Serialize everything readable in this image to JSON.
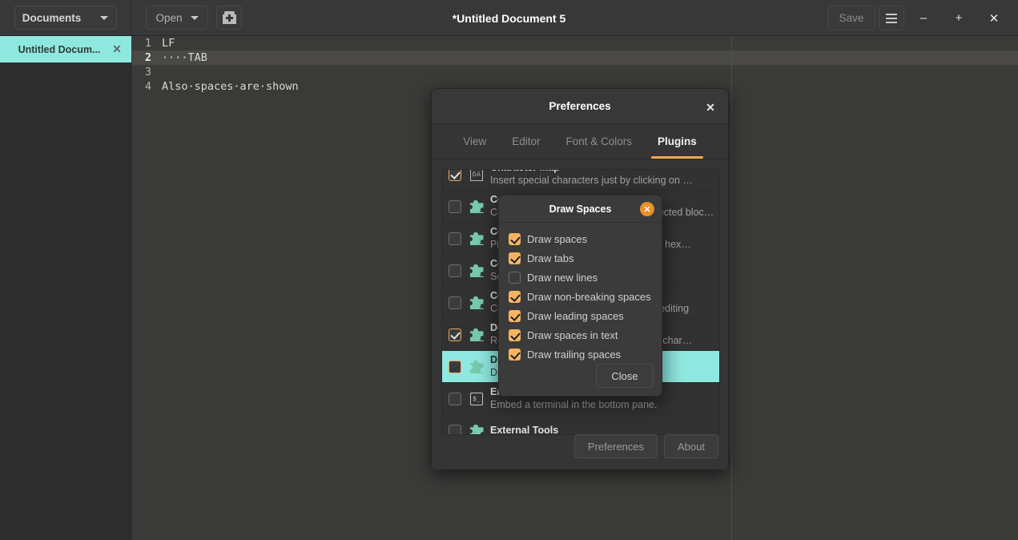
{
  "window": {
    "title": "*Untitled Document 5",
    "documents_label": "Documents",
    "open_label": "Open",
    "save_label": "Save",
    "new_doc_icon": "new-document-icon",
    "menu_icon": "hamburger-menu-icon",
    "minimize_label": "–",
    "maximize_label": "+",
    "close_label": "✕"
  },
  "sidebar": {
    "tabs": [
      {
        "label": "Untitled Docum...",
        "close": "✕",
        "selected": true
      }
    ]
  },
  "editor": {
    "lines": [
      {
        "num": "1",
        "text": "LF",
        "current": false
      },
      {
        "num": "2",
        "text": "····TAB",
        "current": true
      },
      {
        "num": "3",
        "text": "",
        "current": false
      },
      {
        "num": "4",
        "text": "Also·spaces·are·shown",
        "current": false
      }
    ]
  },
  "preferences": {
    "title": "Preferences",
    "close": "✕",
    "tabs": [
      {
        "label": "View",
        "active": false
      },
      {
        "label": "Editor",
        "active": false
      },
      {
        "label": "Font & Colors",
        "active": false
      },
      {
        "label": "Plugins",
        "active": true
      }
    ],
    "accent_color": "#f5a854",
    "plugins": [
      {
        "title": "Character Map",
        "desc": "Insert special characters just by clicking on …",
        "checked": true,
        "icon": "character-map-icon",
        "selected": false
      },
      {
        "title": "Code Comment",
        "desc": "Comment or uncomment blocks of selected bloc…",
        "checked": false,
        "icon": "puzzle-piece-icon",
        "selected": false
      },
      {
        "title": "Color Picker",
        "desc": "Pick a color from a dialog and insert its hex…",
        "checked": false,
        "icon": "puzzle-piece-icon",
        "selected": false
      },
      {
        "title": "Color Scheme Editor",
        "desc": "Source code color schemes editor",
        "checked": false,
        "icon": "puzzle-piece-icon",
        "selected": false
      },
      {
        "title": "Commander",
        "desc": "Command line interface for advanced editing",
        "checked": false,
        "icon": "puzzle-piece-icon",
        "selected": false
      },
      {
        "title": "Document Statistics",
        "desc": "Report the number of words, lines and char…",
        "checked": true,
        "icon": "puzzle-piece-icon",
        "selected": false
      },
      {
        "title": "Draw Spaces",
        "desc": "Draw spaces and tabs",
        "checked": true,
        "icon": "puzzle-piece-icon",
        "selected": true
      },
      {
        "title": "Embedded Terminal",
        "desc": "Embed a terminal in the bottom pane.",
        "checked": false,
        "icon": "terminal-icon",
        "selected": false
      },
      {
        "title": "External Tools",
        "desc": "",
        "checked": false,
        "icon": "puzzle-piece-icon",
        "selected": false
      }
    ],
    "footer": {
      "preferences_label": "Preferences",
      "about_label": "About"
    }
  },
  "draw_spaces": {
    "title": "Draw Spaces",
    "close_icon": "close-circle-icon",
    "options": [
      {
        "label": "Draw spaces",
        "checked": true
      },
      {
        "label": "Draw tabs",
        "checked": true
      },
      {
        "label": "Draw new lines",
        "checked": false
      },
      {
        "label": "Draw non-breaking spaces",
        "checked": true
      },
      {
        "label": "Draw leading spaces",
        "checked": true
      },
      {
        "label": "Draw spaces in text",
        "checked": true
      },
      {
        "label": "Draw trailing spaces",
        "checked": true
      }
    ],
    "close_button": "Close"
  }
}
